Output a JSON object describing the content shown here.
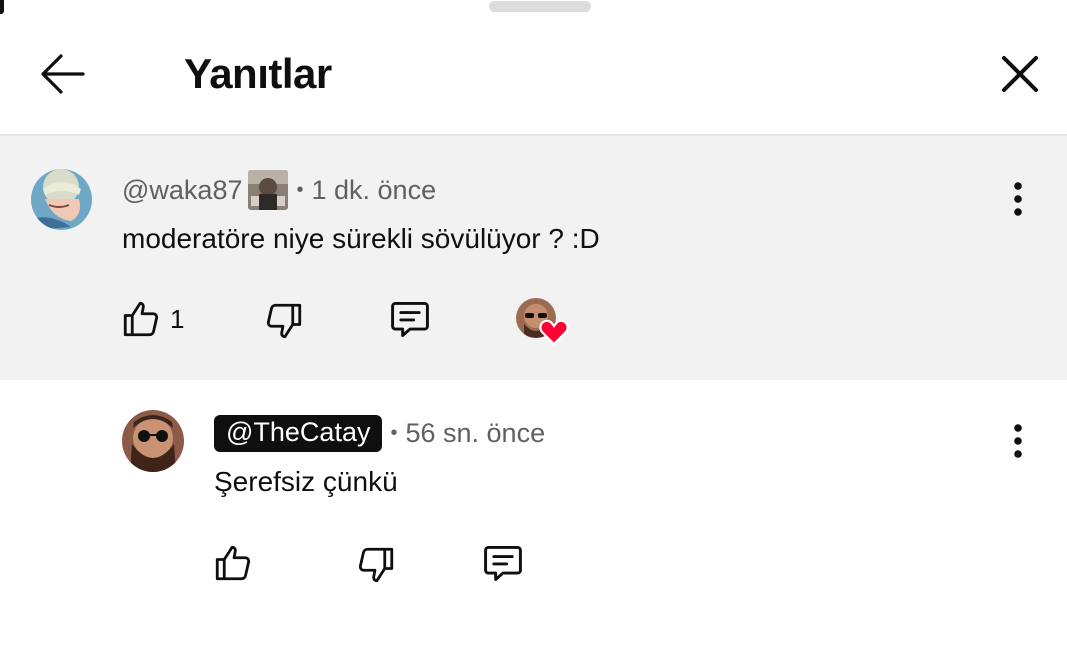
{
  "header": {
    "title": "Yanıtlar"
  },
  "parent_comment": {
    "handle": "@waka87",
    "time": "1 dk. önce",
    "text": "moderatöre niye sürekli sövülüyor ? :D",
    "likes": "1"
  },
  "reply_comment": {
    "handle": "@TheCatay",
    "time": "56 sn. önce",
    "text": "Şerefsiz çünkü"
  },
  "colors": {
    "highlight_bg": "#f2f2f2",
    "heart": "#ff0033",
    "text_primary": "#0f0f0f",
    "text_secondary": "#606060"
  }
}
